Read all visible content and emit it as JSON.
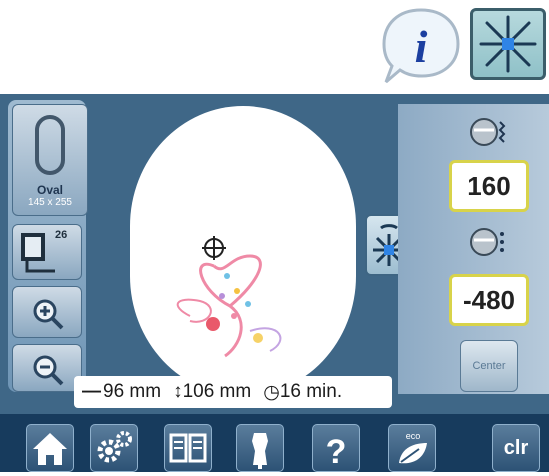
{
  "header_icons": [
    {
      "name": "info-icon"
    },
    {
      "name": "move-pattern-icon"
    }
  ],
  "hoop": {
    "name": "Oval",
    "size": "145 x 255",
    "icon": "oval-hoop-icon"
  },
  "left_tools": [
    {
      "icon": "hoop-select-icon",
      "label": "26"
    },
    {
      "icon": "zoom-in-icon"
    },
    {
      "icon": "zoom-out-icon"
    }
  ],
  "position": {
    "horizontal_value": "160",
    "vertical_value": "-480",
    "center_label": "Center"
  },
  "status": {
    "width": "96 mm",
    "height": "106 mm",
    "time": "16 min."
  },
  "bottom_buttons": [
    {
      "icon": "home-icon"
    },
    {
      "icon": "settings-icon"
    },
    {
      "icon": "tutorial-book-icon"
    },
    {
      "icon": "creative-consultant-icon"
    },
    {
      "icon": "help-icon"
    },
    {
      "icon": "eco-icon"
    },
    {
      "label": "clr"
    }
  ],
  "colors": {
    "screen_bg": "#3f6787",
    "value_border": "#d8d34a",
    "bottom_bar": "#173b5d"
  }
}
